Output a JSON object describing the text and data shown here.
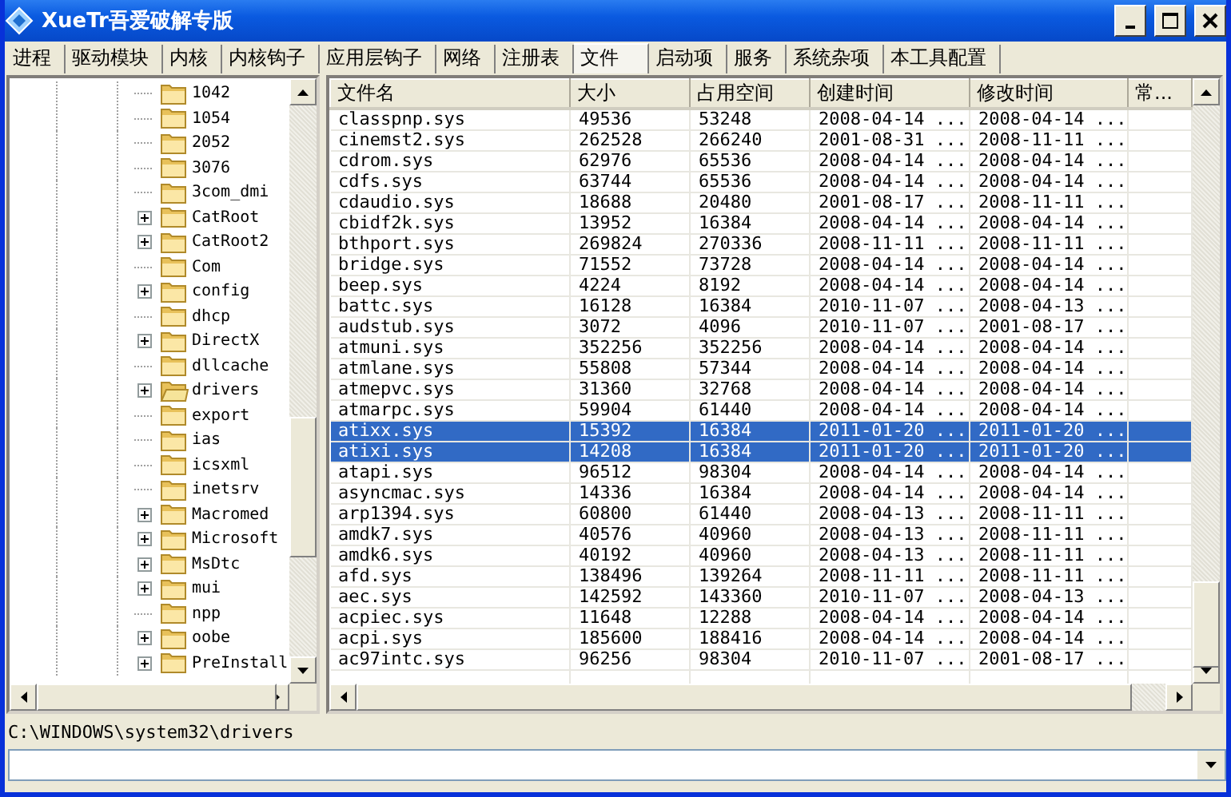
{
  "window": {
    "title": "XueTr吾爱破解专版"
  },
  "tabs": [
    {
      "label": "进程",
      "selected": false
    },
    {
      "label": "驱动模块",
      "selected": false
    },
    {
      "label": "内核",
      "selected": false
    },
    {
      "label": "内核钩子",
      "selected": false
    },
    {
      "label": "应用层钩子",
      "selected": false
    },
    {
      "label": "网络",
      "selected": false
    },
    {
      "label": "注册表",
      "selected": false
    },
    {
      "label": "文件",
      "selected": true
    },
    {
      "label": "启动项",
      "selected": false
    },
    {
      "label": "服务",
      "selected": false
    },
    {
      "label": "系统杂项",
      "selected": false
    },
    {
      "label": "本工具配置",
      "selected": false
    }
  ],
  "folder_tree": [
    {
      "name": "1042",
      "expandable": false,
      "selected": false
    },
    {
      "name": "1054",
      "expandable": false,
      "selected": false
    },
    {
      "name": "2052",
      "expandable": false,
      "selected": false
    },
    {
      "name": "3076",
      "expandable": false,
      "selected": false
    },
    {
      "name": "3com_dmi",
      "expandable": false,
      "selected": false
    },
    {
      "name": "CatRoot",
      "expandable": true,
      "selected": false
    },
    {
      "name": "CatRoot2",
      "expandable": true,
      "selected": false
    },
    {
      "name": "Com",
      "expandable": false,
      "selected": false
    },
    {
      "name": "config",
      "expandable": true,
      "selected": false
    },
    {
      "name": "dhcp",
      "expandable": false,
      "selected": false
    },
    {
      "name": "DirectX",
      "expandable": true,
      "selected": false
    },
    {
      "name": "dllcache",
      "expandable": false,
      "selected": false
    },
    {
      "name": "drivers",
      "expandable": true,
      "selected": true
    },
    {
      "name": "export",
      "expandable": false,
      "selected": false
    },
    {
      "name": "ias",
      "expandable": false,
      "selected": false
    },
    {
      "name": "icsxml",
      "expandable": false,
      "selected": false
    },
    {
      "name": "inetsrv",
      "expandable": false,
      "selected": false
    },
    {
      "name": "Macromed",
      "expandable": true,
      "selected": false
    },
    {
      "name": "Microsoft",
      "expandable": true,
      "selected": false
    },
    {
      "name": "MsDtc",
      "expandable": true,
      "selected": false
    },
    {
      "name": "mui",
      "expandable": true,
      "selected": false
    },
    {
      "name": "npp",
      "expandable": false,
      "selected": false
    },
    {
      "name": "oobe",
      "expandable": true,
      "selected": false
    },
    {
      "name": "PreInstall",
      "expandable": true,
      "selected": false
    }
  ],
  "file_table": {
    "columns": [
      "文件名",
      "大小",
      "占用空间",
      "创建时间",
      "修改时间",
      "常..."
    ],
    "rows": [
      {
        "cells": [
          "classpnp.sys",
          "49536",
          "53248",
          "2008-04-14 ...",
          "2008-04-14 ..."
        ],
        "selected": false
      },
      {
        "cells": [
          "cinemst2.sys",
          "262528",
          "266240",
          "2001-08-31 ...",
          "2008-11-11 ..."
        ],
        "selected": false
      },
      {
        "cells": [
          "cdrom.sys",
          "62976",
          "65536",
          "2008-04-14 ...",
          "2008-04-14 ..."
        ],
        "selected": false
      },
      {
        "cells": [
          "cdfs.sys",
          "63744",
          "65536",
          "2008-04-14 ...",
          "2008-04-14 ..."
        ],
        "selected": false
      },
      {
        "cells": [
          "cdaudio.sys",
          "18688",
          "20480",
          "2001-08-17 ...",
          "2008-11-11 ..."
        ],
        "selected": false
      },
      {
        "cells": [
          "cbidf2k.sys",
          "13952",
          "16384",
          "2008-04-14 ...",
          "2008-04-14 ..."
        ],
        "selected": false
      },
      {
        "cells": [
          "bthport.sys",
          "269824",
          "270336",
          "2008-11-11 ...",
          "2008-11-11 ..."
        ],
        "selected": false
      },
      {
        "cells": [
          "bridge.sys",
          "71552",
          "73728",
          "2008-04-14 ...",
          "2008-04-14 ..."
        ],
        "selected": false
      },
      {
        "cells": [
          "beep.sys",
          "4224",
          "8192",
          "2008-04-14 ...",
          "2008-04-14 ..."
        ],
        "selected": false
      },
      {
        "cells": [
          "battc.sys",
          "16128",
          "16384",
          "2010-11-07 ...",
          "2008-04-13 ..."
        ],
        "selected": false
      },
      {
        "cells": [
          "audstub.sys",
          "3072",
          "4096",
          "2010-11-07 ...",
          "2001-08-17 ..."
        ],
        "selected": false
      },
      {
        "cells": [
          "atmuni.sys",
          "352256",
          "352256",
          "2008-04-14 ...",
          "2008-04-14 ..."
        ],
        "selected": false
      },
      {
        "cells": [
          "atmlane.sys",
          "55808",
          "57344",
          "2008-04-14 ...",
          "2008-04-14 ..."
        ],
        "selected": false
      },
      {
        "cells": [
          "atmepvc.sys",
          "31360",
          "32768",
          "2008-04-14 ...",
          "2008-04-14 ..."
        ],
        "selected": false
      },
      {
        "cells": [
          "atmarpc.sys",
          "59904",
          "61440",
          "2008-04-14 ...",
          "2008-04-14 ..."
        ],
        "selected": false
      },
      {
        "cells": [
          "atixx.sys",
          "15392",
          "16384",
          "2011-01-20 ...",
          "2011-01-20 ..."
        ],
        "selected": true
      },
      {
        "cells": [
          "atixi.sys",
          "14208",
          "16384",
          "2011-01-20 ...",
          "2011-01-20 ..."
        ],
        "selected": true
      },
      {
        "cells": [
          "atapi.sys",
          "96512",
          "98304",
          "2008-04-14 ...",
          "2008-04-14 ..."
        ],
        "selected": false
      },
      {
        "cells": [
          "asyncmac.sys",
          "14336",
          "16384",
          "2008-04-14 ...",
          "2008-04-14 ..."
        ],
        "selected": false
      },
      {
        "cells": [
          "arp1394.sys",
          "60800",
          "61440",
          "2008-04-13 ...",
          "2008-11-11 ..."
        ],
        "selected": false
      },
      {
        "cells": [
          "amdk7.sys",
          "40576",
          "40960",
          "2008-04-13 ...",
          "2008-11-11 ..."
        ],
        "selected": false
      },
      {
        "cells": [
          "amdk6.sys",
          "40192",
          "40960",
          "2008-04-13 ...",
          "2008-11-11 ..."
        ],
        "selected": false
      },
      {
        "cells": [
          "afd.sys",
          "138496",
          "139264",
          "2008-11-11 ...",
          "2008-11-11 ..."
        ],
        "selected": false
      },
      {
        "cells": [
          "aec.sys",
          "142592",
          "143360",
          "2010-11-07 ...",
          "2008-04-13 ..."
        ],
        "selected": false
      },
      {
        "cells": [
          "acpiec.sys",
          "11648",
          "12288",
          "2008-04-14 ...",
          "2008-04-14 ..."
        ],
        "selected": false
      },
      {
        "cells": [
          "acpi.sys",
          "185600",
          "188416",
          "2008-04-14 ...",
          "2008-04-14 ..."
        ],
        "selected": false
      },
      {
        "cells": [
          "ac97intc.sys",
          "96256",
          "98304",
          "2010-11-07 ...",
          "2001-08-17 ..."
        ],
        "selected": false
      }
    ]
  },
  "status_bar": {
    "path": "C:\\WINDOWS\\system32\\drivers"
  }
}
